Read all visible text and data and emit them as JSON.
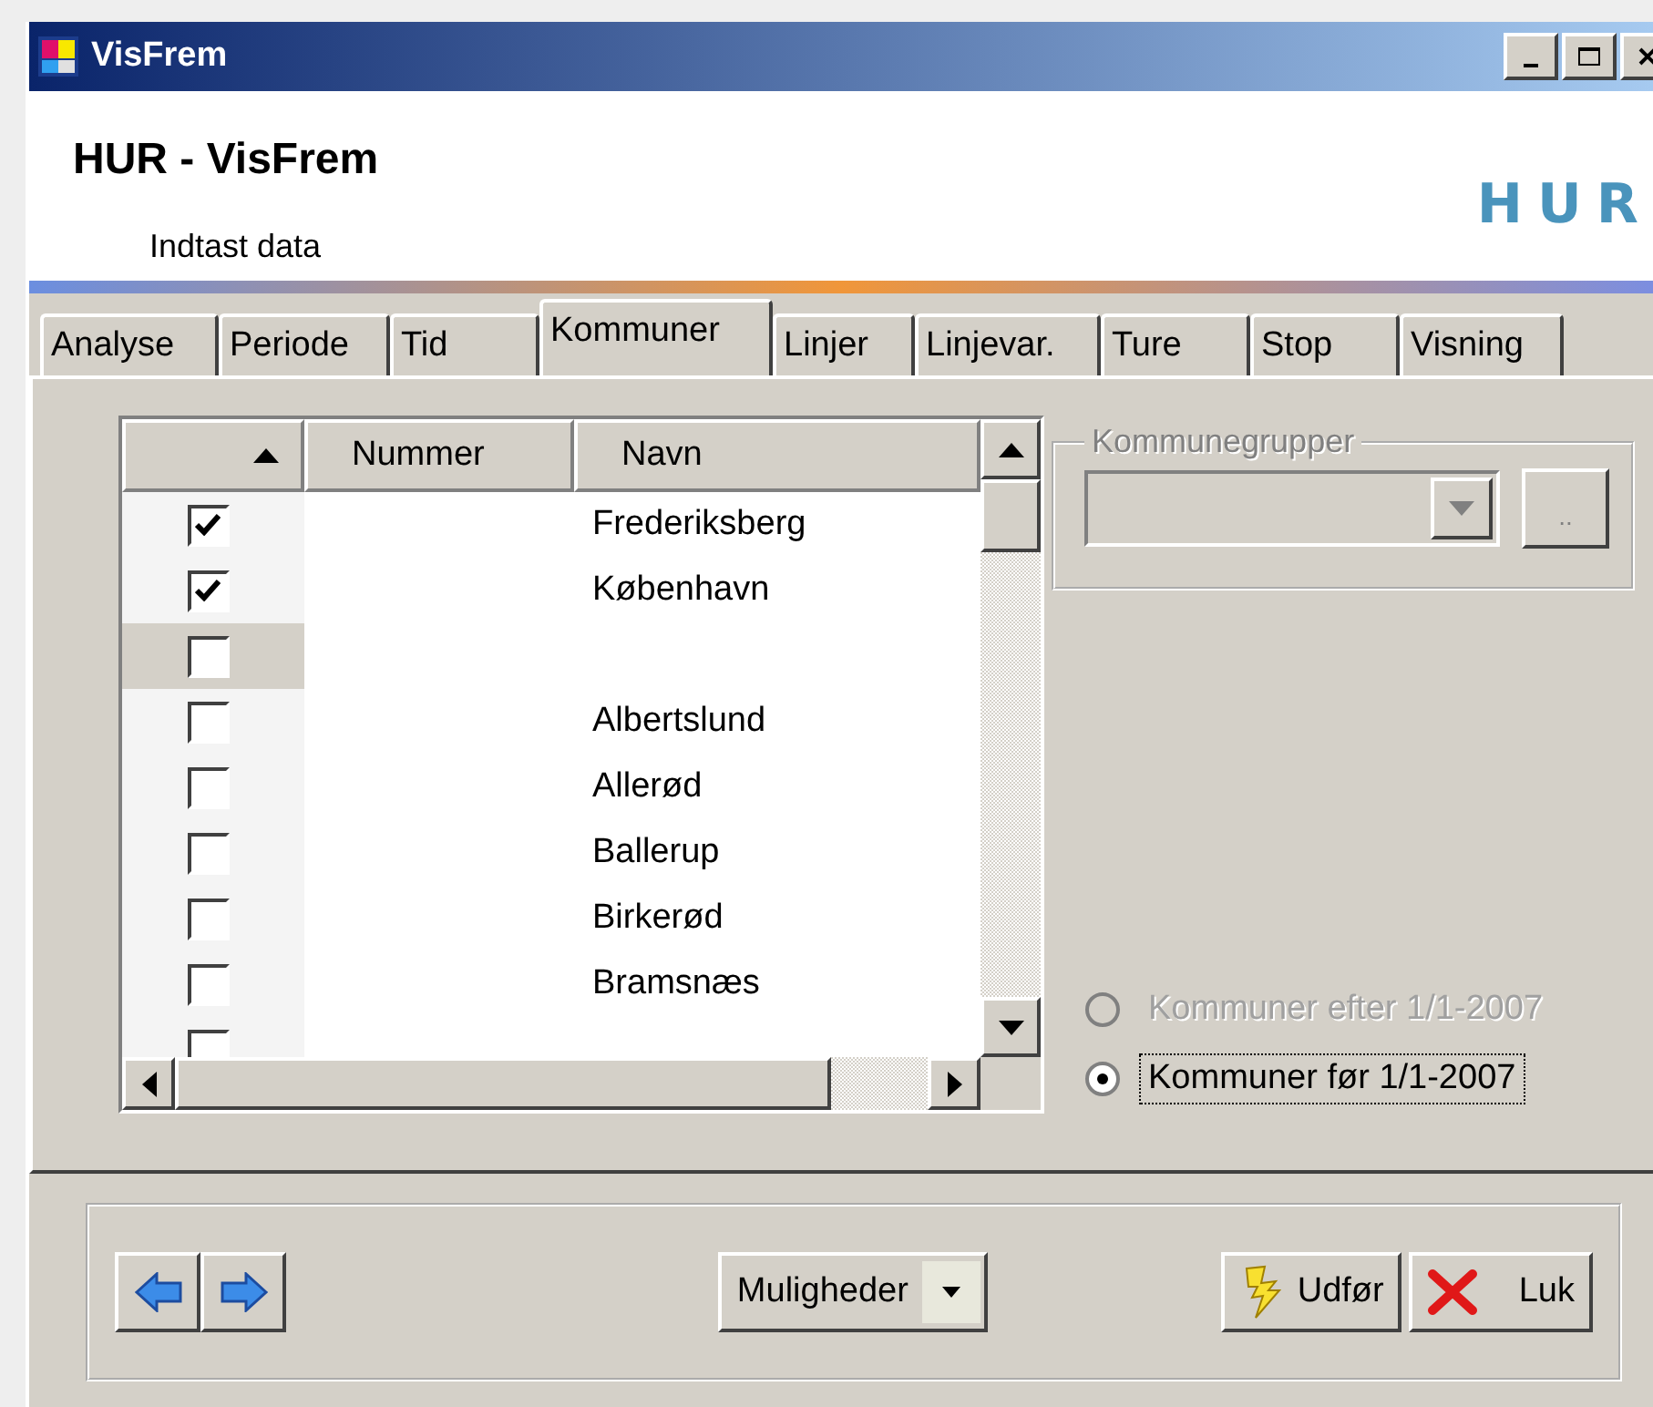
{
  "window": {
    "title": "VisFrem"
  },
  "header": {
    "title": "HUR - VisFrem",
    "subtitle": "Indtast data",
    "logo": "HUR"
  },
  "tabs": [
    {
      "label": "Analyse",
      "selected": false
    },
    {
      "label": "Periode",
      "selected": false
    },
    {
      "label": "Tid",
      "selected": false
    },
    {
      "label": "Kommuner",
      "selected": true
    },
    {
      "label": "Linjer",
      "selected": false
    },
    {
      "label": "Linjevar.",
      "selected": false
    },
    {
      "label": "Ture",
      "selected": false
    },
    {
      "label": "Stop",
      "selected": false
    },
    {
      "label": "Visning",
      "selected": false
    }
  ],
  "grid": {
    "columns": [
      {
        "sorted": true
      },
      {
        "label": "Nummer",
        "sorted": false
      },
      {
        "label": "Navn",
        "sorted": false
      }
    ],
    "rows": [
      {
        "checked": true,
        "selected": false,
        "name": "Frederiksberg"
      },
      {
        "checked": true,
        "selected": false,
        "name": "København"
      },
      {
        "checked": false,
        "selected": true
      },
      {
        "checked": false,
        "selected": false,
        "name": "Albertslund"
      },
      {
        "checked": false,
        "selected": false,
        "name": "Allerød"
      },
      {
        "checked": false,
        "selected": false,
        "name": "Ballerup"
      },
      {
        "checked": false,
        "selected": false,
        "name": "Birkerød"
      },
      {
        "checked": false,
        "selected": false,
        "name": "Bramsnæs"
      },
      {
        "checked": false,
        "selected": false
      }
    ]
  },
  "group": {
    "label": "Kommunegrupper",
    "disabled": true,
    "browse_button": ".."
  },
  "radios": [
    {
      "label": "Kommuner efter 1/1-2007",
      "selected": false,
      "disabled": true,
      "focused": false
    },
    {
      "label": "Kommuner før 1/1-2007",
      "selected": true,
      "disabled": false,
      "focused": true
    }
  ],
  "footer": {
    "options_button": "Muligheder",
    "buttons": [
      {
        "label": "Udfør",
        "kind": "run"
      },
      {
        "label": "Luk",
        "kind": "close"
      }
    ]
  }
}
